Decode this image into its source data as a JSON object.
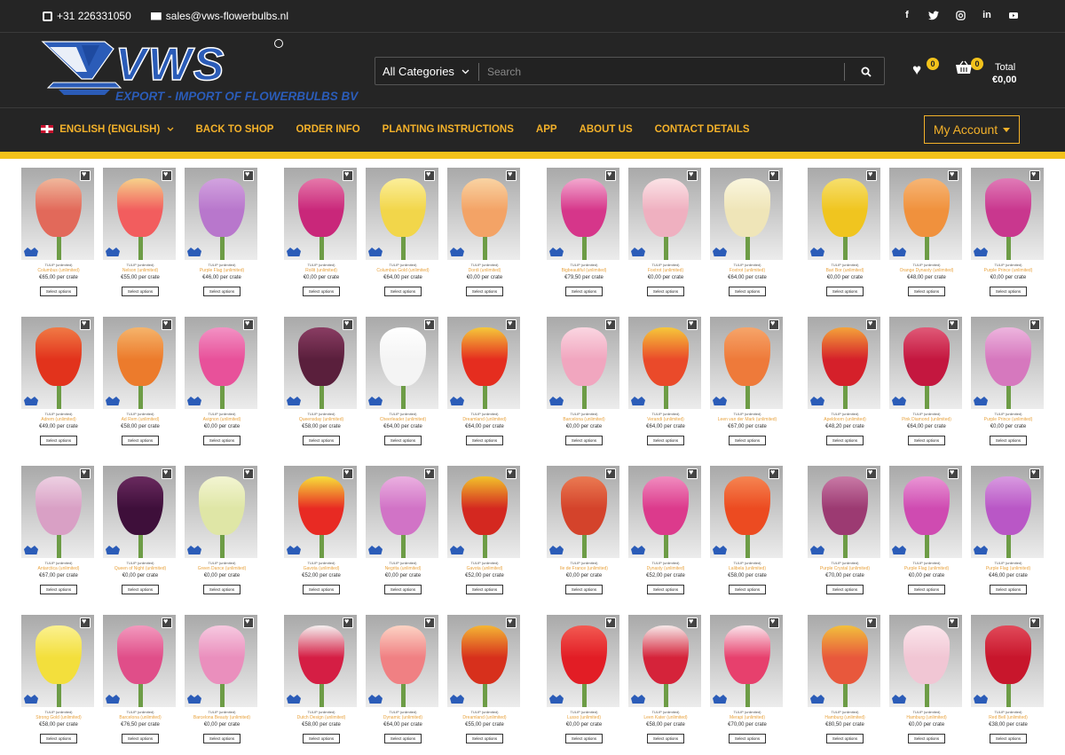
{
  "topbar": {
    "phone": "+31 226331050",
    "email": "sales@vws-flowerbulbs.nl",
    "social_icons": [
      "facebook-icon",
      "twitter-icon",
      "instagram-icon",
      "linkedin-icon",
      "youtube-icon"
    ]
  },
  "logo": {
    "mark": "VWS",
    "tagline": "EXPORT - IMPORT OF FLOWERBULBS BV"
  },
  "search": {
    "category": "All Categories",
    "placeholder": "Search"
  },
  "wishlist": {
    "count": "0"
  },
  "cart": {
    "count": "0",
    "total_label": "Total",
    "total_value": "€0,00"
  },
  "nav": {
    "language": "ENGLISH (ENGLISH)",
    "items": [
      "BACK TO SHOP",
      "ORDER INFO",
      "PLANTING INSTRUCTIONS",
      "APP",
      "ABOUT US",
      "CONTACT DETAILS"
    ],
    "account": "My Account"
  },
  "colors": {
    "dark": "#252525",
    "accent": "#f3b12a",
    "yellow_bar": "#f3c21b",
    "logo_blue": "#2b5cb8"
  },
  "products": {
    "button_label": "Select options",
    "rows": [
      [
        {
          "name": "Columbus (unlimited)",
          "price": "€65,00 per crate",
          "bloom": "#e2695a",
          "tip": "#f0b79b"
        },
        {
          "name": "Nelson (unlimited)",
          "price": "€55,00 per crate",
          "bloom": "#f25d5e",
          "tip": "#f6d18a"
        },
        {
          "name": "Purple Flag (unlimited)",
          "price": "€46,00 per crate",
          "bloom": "#b877cc",
          "tip": "#d2a3df"
        },
        {
          "name": "Rollit (unlimited)",
          "price": "€0,00 per crate",
          "bloom": "#c9277a",
          "tip": "#e579aa"
        },
        {
          "name": "Columbus Gold (unlimited)",
          "price": "€64,00 per crate",
          "bloom": "#f2d64a",
          "tip": "#fbee9a"
        },
        {
          "name": "Dordi (unlimited)",
          "price": "€0,00 per crate",
          "bloom": "#f3a366",
          "tip": "#f9d3a3"
        },
        {
          "name": "Bigbeautiful (unlimited)",
          "price": "€79,50 per crate",
          "bloom": "#d6368a",
          "tip": "#f2a9cf"
        },
        {
          "name": "Foxtrot (unlimited)",
          "price": "€0,00 per crate",
          "bloom": "#efb0c0",
          "tip": "#fbe3e6"
        },
        {
          "name": "Foxtrot (unlimited)",
          "price": "€64,00 per crate",
          "bloom": "#efe5b8",
          "tip": "#faf6de"
        },
        {
          "name": "Bari Bor (unlimited)",
          "price": "€0,00 per crate",
          "bloom": "#f0c51f",
          "tip": "#f6df6d"
        },
        {
          "name": "Orange Dynasty (unlimited)",
          "price": "€48,00 per crate",
          "bloom": "#f0913d",
          "tip": "#f6b676"
        },
        {
          "name": "Purple Prince (unlimited)",
          "price": "€0,00 per crate",
          "bloom": "#c9378e",
          "tip": "#e07bb7"
        }
      ],
      [
        {
          "name": "Adrem (unlimited)",
          "price": "€49,00 per crate",
          "bloom": "#e2331c",
          "tip": "#f07a45"
        },
        {
          "name": "Ad Rem (unlimited)",
          "price": "€58,00 per crate",
          "bloom": "#ec7b2c",
          "tip": "#f5b46b"
        },
        {
          "name": "Avignon (unlimited)",
          "price": "€0,00 per crate",
          "bloom": "#e8519a",
          "tip": "#f292c4"
        },
        {
          "name": "Queensday (unlimited)",
          "price": "€58,00 per crate",
          "bloom": "#5a1f3c",
          "tip": "#8a3d63"
        },
        {
          "name": "Cheerleader (unlimited)",
          "price": "€64,00 per crate",
          "bloom": "#f4f4f4",
          "tip": "#ffffff"
        },
        {
          "name": "Dreamland (unlimited)",
          "price": "€64,00 per crate",
          "bloom": "#e52d1f",
          "tip": "#f5c83a"
        },
        {
          "name": "Barcelona (unlimited)",
          "price": "€0,00 per crate",
          "bloom": "#f1a6bf",
          "tip": "#fad6e1"
        },
        {
          "name": "Verandi (unlimited)",
          "price": "€64,00 per crate",
          "bloom": "#ea4a2a",
          "tip": "#f6c73a"
        },
        {
          "name": "Leen van der Mark (unlimited)",
          "price": "€67,00 per crate",
          "bloom": "#ee7a3a",
          "tip": "#f6a56a"
        },
        {
          "name": "Apeldoorn (unlimited)",
          "price": "€48,20 per crate",
          "bloom": "#d5202a",
          "tip": "#f4a33a"
        },
        {
          "name": "Pink Diamond (unlimited)",
          "price": "€64,00 per crate",
          "bloom": "#c4173f",
          "tip": "#e05a78"
        },
        {
          "name": "Purple Prince (unlimited)",
          "price": "€0,00 per crate",
          "bloom": "#d678be",
          "tip": "#edb5de"
        }
      ],
      [
        {
          "name": "Antarctica (unlimited)",
          "price": "€67,00 per crate",
          "bloom": "#d9a0c5",
          "tip": "#edd0e2"
        },
        {
          "name": "Queen of Night (unlimited)",
          "price": "€0,00 per crate",
          "bloom": "#3e0f3a",
          "tip": "#6a2a5f"
        },
        {
          "name": "Green Dance (unlimited)",
          "price": "€0,00 per crate",
          "bloom": "#dfe6a6",
          "tip": "#f3f5d2"
        },
        {
          "name": "Gavota (unlimited)",
          "price": "€52,00 per crate",
          "bloom": "#e82a23",
          "tip": "#f7df3a"
        },
        {
          "name": "Negrita (unlimited)",
          "price": "€0,00 per crate",
          "bloom": "#d173c6",
          "tip": "#eab0e0"
        },
        {
          "name": "Gavota (unlimited)",
          "price": "€52,00 per crate",
          "bloom": "#d42820",
          "tip": "#f2c22a"
        },
        {
          "name": "Ile de France (unlimited)",
          "price": "€0,00 per crate",
          "bloom": "#d4432b",
          "tip": "#ea7a52"
        },
        {
          "name": "Dynasty (unlimited)",
          "price": "€52,00 per crate",
          "bloom": "#dc3a8c",
          "tip": "#f08cbf"
        },
        {
          "name": "Lalibela (unlimited)",
          "price": "€58,00 per crate",
          "bloom": "#ec4b21",
          "tip": "#f58551"
        },
        {
          "name": "Purple Crystal (unlimited)",
          "price": "€70,00 per crate",
          "bloom": "#9c3a72",
          "tip": "#c97aa6"
        },
        {
          "name": "Purple Flag (unlimited)",
          "price": "€0,00 per crate",
          "bloom": "#cf4bb1",
          "tip": "#e996d5"
        },
        {
          "name": "Purple Flag (unlimited)",
          "price": "€46,00 per crate",
          "bloom": "#b957c6",
          "tip": "#d89ae0"
        }
      ],
      [
        {
          "name": "Strong Gold (unlimited)",
          "price": "€58,00 per crate",
          "bloom": "#f3df3c",
          "tip": "#fbf190"
        },
        {
          "name": "Barcelona (unlimited)",
          "price": "€76,50 per crate",
          "bloom": "#e04e89",
          "tip": "#f29abe"
        },
        {
          "name": "Barcelona Beauty (unlimited)",
          "price": "€0,00 per crate",
          "bloom": "#ea8fbd",
          "tip": "#f6c9e0"
        },
        {
          "name": "Dutch Design (unlimited)",
          "price": "€58,00 per crate",
          "bloom": "#d51e44",
          "tip": "#f5f0f0"
        },
        {
          "name": "Dynamic (unlimited)",
          "price": "€64,00 per crate",
          "bloom": "#f08083",
          "tip": "#fcd3c4"
        },
        {
          "name": "Dreamland (unlimited)",
          "price": "€55,00 per crate",
          "bloom": "#d7301c",
          "tip": "#f4b534"
        },
        {
          "name": "Lusso (unlimited)",
          "price": "€0,00 per crate",
          "bloom": "#e21d25",
          "tip": "#f25a52"
        },
        {
          "name": "Leen Kater (unlimited)",
          "price": "€58,00 per crate",
          "bloom": "#d5233a",
          "tip": "#f7e9e9"
        },
        {
          "name": "Merapi (unlimited)",
          "price": "€70,00 per crate",
          "bloom": "#e7406d",
          "tip": "#fae4ea"
        },
        {
          "name": "Hamburg (unlimited)",
          "price": "€80,50 per crate",
          "bloom": "#e8583c",
          "tip": "#f2bf3c"
        },
        {
          "name": "Hamburg (unlimited)",
          "price": "€0,00 per crate",
          "bloom": "#f1c6d4",
          "tip": "#fbe6ec"
        },
        {
          "name": "Red Bell (unlimited)",
          "price": "€38,00 per crate",
          "bloom": "#c8162c",
          "tip": "#e14a5a"
        }
      ]
    ]
  }
}
